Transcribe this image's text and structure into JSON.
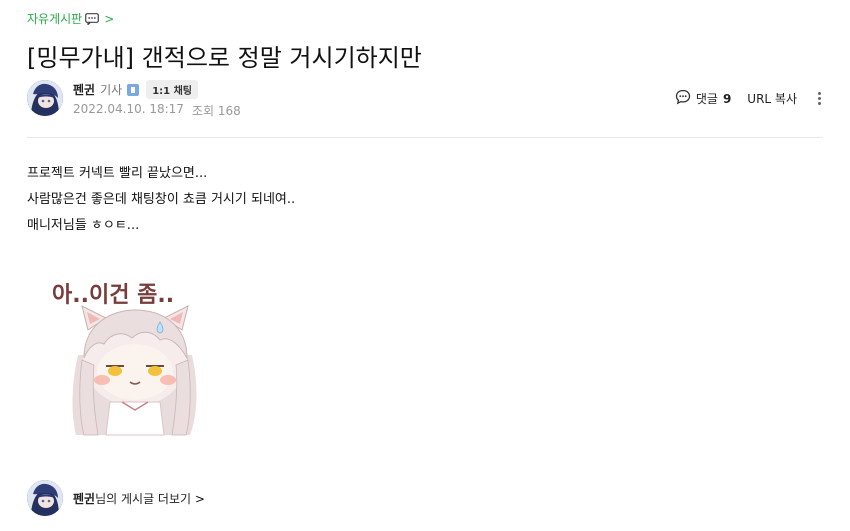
{
  "breadcrumb": {
    "board_name": "자유게시판",
    "chevron": ">"
  },
  "post": {
    "title": "[밍무가내] 갠적으로 정말 거시기하지만",
    "author": {
      "name": "펜귄",
      "level": "기사",
      "chat_label": "1:1 채팅"
    },
    "date": "2022.04.10. 18:17",
    "views_label": "조회",
    "views": "168",
    "comments_label": "댓글",
    "comments_count": "9",
    "url_copy_label": "URL 복사",
    "body_lines": [
      "프로젝트 커넥트 빨리 끝났으면...",
      "사람많은건 좋은데 채팅창이 쵸큼 거시기 되네여..",
      "매니저님들 ㅎㅇㅌ..."
    ],
    "sticker_text": "아..이건 좀.."
  },
  "footer": {
    "author_name": "펜귄",
    "more_posts_suffix": "님의 게시글 더보기",
    "chevron": ">"
  },
  "colors": {
    "accent": "#2bab48",
    "divider": "#e8e8e8"
  }
}
